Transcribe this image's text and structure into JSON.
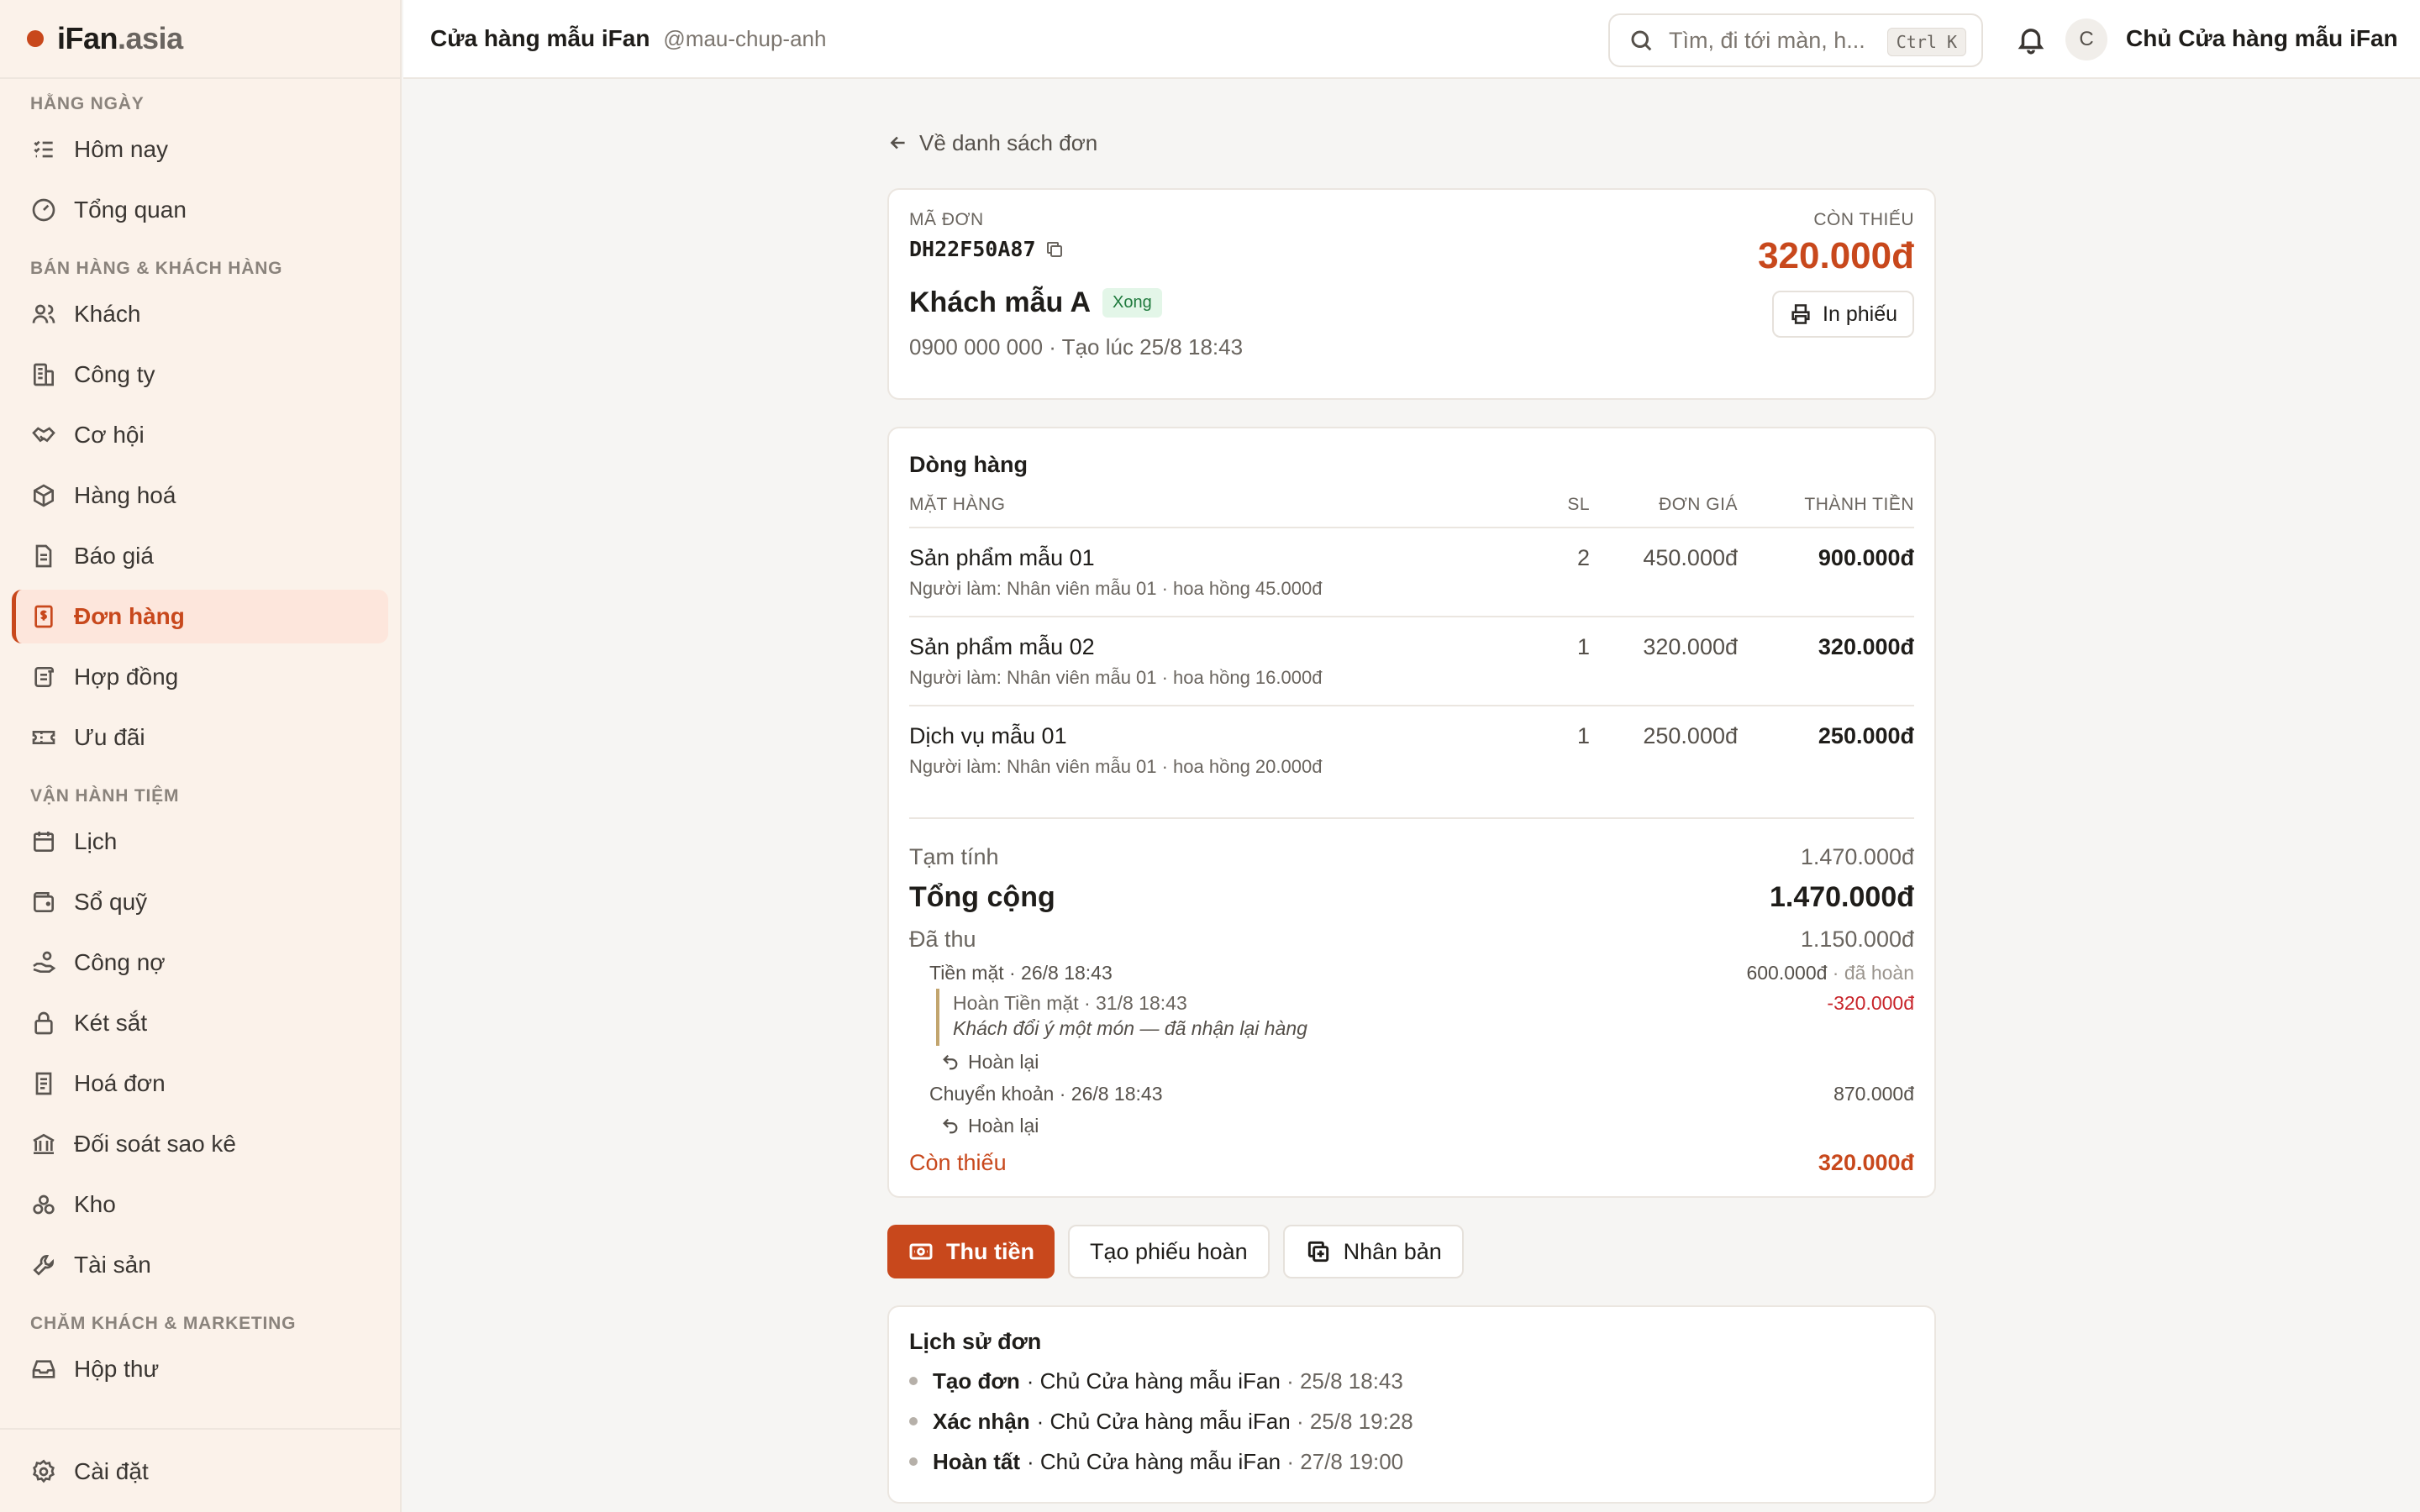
{
  "brand": {
    "name": "iFan",
    "tld": ".asia"
  },
  "sidebar": {
    "sections": [
      {
        "title": "HẰNG NGÀY",
        "items": [
          {
            "label": "Hôm nay",
            "icon": "list-check-icon"
          },
          {
            "label": "Tổng quan",
            "icon": "gauge-icon"
          }
        ]
      },
      {
        "title": "BÁN HÀNG & KHÁCH HÀNG",
        "items": [
          {
            "label": "Khách",
            "icon": "users-icon"
          },
          {
            "label": "Công ty",
            "icon": "building-icon"
          },
          {
            "label": "Cơ hội",
            "icon": "handshake-icon"
          },
          {
            "label": "Hàng hoá",
            "icon": "box-icon"
          },
          {
            "label": "Báo giá",
            "icon": "document-icon"
          },
          {
            "label": "Đơn hàng",
            "icon": "receipt-dollar-icon",
            "active": true
          },
          {
            "label": "Hợp đồng",
            "icon": "scroll-icon"
          },
          {
            "label": "Ưu đãi",
            "icon": "ticket-icon"
          }
        ]
      },
      {
        "title": "VẬN HÀNH TIỆM",
        "items": [
          {
            "label": "Lịch",
            "icon": "calendar-icon"
          },
          {
            "label": "Sổ quỹ",
            "icon": "wallet-icon"
          },
          {
            "label": "Công nợ",
            "icon": "hand-coins-icon"
          },
          {
            "label": "Két sắt",
            "icon": "lock-icon"
          },
          {
            "label": "Hoá đơn",
            "icon": "invoice-icon"
          },
          {
            "label": "Đối soát sao kê",
            "icon": "bank-icon"
          },
          {
            "label": "Kho",
            "icon": "boxes-icon"
          },
          {
            "label": "Tài sản",
            "icon": "wrench-icon"
          }
        ]
      },
      {
        "title": "CHĂM KHÁCH & MARKETING",
        "items": [
          {
            "label": "Hộp thư",
            "icon": "inbox-icon"
          }
        ]
      }
    ],
    "footer": {
      "label": "Cài đặt",
      "icon": "gear-icon"
    }
  },
  "topbar": {
    "shop_name": "Cửa hàng mẫu iFan",
    "shop_handle": "@mau-chup-anh",
    "search_placeholder": "Tìm, đi tới màn, h...",
    "search_shortcut": "Ctrl K",
    "avatar_initial": "C",
    "user_name": "Chủ Cửa hàng mẫu iFan"
  },
  "order": {
    "back_label": "Về danh sách đơn",
    "code_label": "MÃ ĐƠN",
    "code": "DH22F50A87",
    "customer": "Khách mẫu A",
    "status": "Xong",
    "meta": "0900 000 000 · Tạo lúc 25/8 18:43",
    "owing_label": "CÒN THIẾU",
    "owing": "320.000đ",
    "print_label": "In phiếu"
  },
  "lines": {
    "title": "Dòng hàng",
    "headers": {
      "item": "MẶT HÀNG",
      "qty": "SL",
      "price": "ĐƠN GIÁ",
      "total": "THÀNH TIỀN"
    },
    "rows": [
      {
        "name": "Sản phẩm mẫu 01",
        "sub": "Người làm: Nhân viên mẫu 01 · hoa hồng 45.000đ",
        "qty": "2",
        "price": "450.000đ",
        "total": "900.000đ"
      },
      {
        "name": "Sản phẩm mẫu 02",
        "sub": "Người làm: Nhân viên mẫu 01 · hoa hồng 16.000đ",
        "qty": "1",
        "price": "320.000đ",
        "total": "320.000đ"
      },
      {
        "name": "Dịch vụ mẫu 01",
        "sub": "Người làm: Nhân viên mẫu 01 · hoa hồng 20.000đ",
        "qty": "1",
        "price": "250.000đ",
        "total": "250.000đ"
      }
    ],
    "summary": {
      "subtotal_label": "Tạm tính",
      "subtotal": "1.470.000đ",
      "total_label": "Tổng cộng",
      "total": "1.470.000đ",
      "paid_label": "Đã thu",
      "paid": "1.150.000đ",
      "payments": [
        {
          "label": "Tiền mặt · 26/8 18:43",
          "amount": "600.000đ",
          "tag": "· đã hoàn",
          "refund": {
            "label": "Hoàn Tiền mặt · 31/8 18:43",
            "amount": "-320.000đ",
            "note": "Khách đổi ý một món — đã nhận lại hàng"
          },
          "undo_label": "Hoàn lại"
        },
        {
          "label": "Chuyển khoản · 26/8 18:43",
          "amount": "870.000đ",
          "undo_label": "Hoàn lại"
        }
      ],
      "owing_label": "Còn thiếu",
      "owing": "320.000đ"
    }
  },
  "actions": {
    "collect": "Thu tiền",
    "refund": "Tạo phiếu hoàn",
    "duplicate": "Nhân bản"
  },
  "history": {
    "title": "Lịch sử đơn",
    "items": [
      {
        "action": "Tạo đơn",
        "by": "· Chủ Cửa hàng mẫu iFan",
        "time": "· 25/8 18:43"
      },
      {
        "action": "Xác nhận",
        "by": "· Chủ Cửa hàng mẫu iFan",
        "time": "· 25/8 19:28"
      },
      {
        "action": "Hoàn tất",
        "by": "· Chủ Cửa hàng mẫu iFan",
        "time": "· 27/8 19:00"
      }
    ]
  },
  "colors": {
    "accent": "#c8481c",
    "success": "#1f7a3d",
    "danger": "#c8242a",
    "sidebar_bg": "#fbf2ea"
  }
}
